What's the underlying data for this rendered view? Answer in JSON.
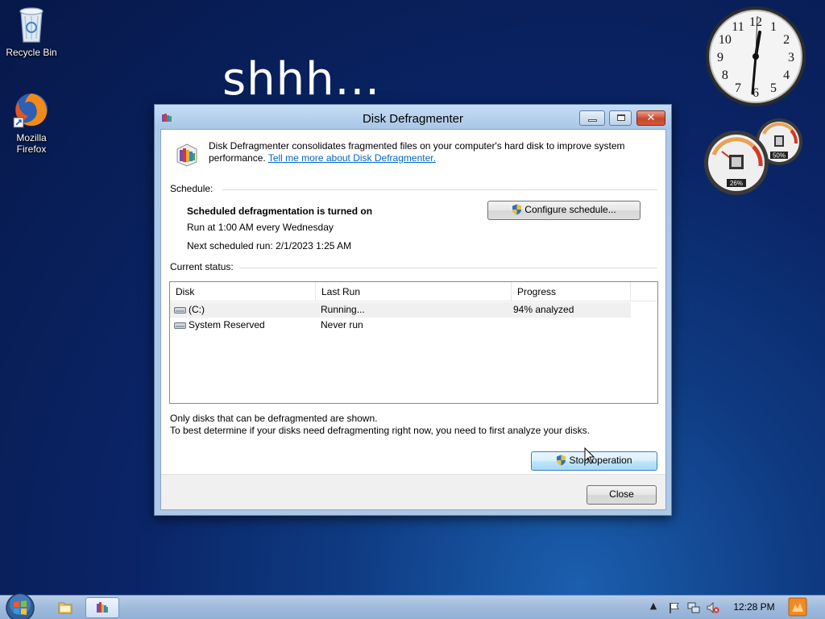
{
  "desktop": {
    "icons": [
      {
        "label": "Recycle Bin",
        "icon": "recycle-bin-icon"
      },
      {
        "label": "Mozilla\nFirefox",
        "icon": "firefox-icon"
      }
    ],
    "wallpaper_text": "shhh..."
  },
  "gadgets": {
    "clock": {
      "time": "12:28",
      "numerals": [
        "12",
        "1",
        "2",
        "3",
        "4",
        "5",
        "6",
        "7",
        "8",
        "9",
        "10",
        "11"
      ]
    },
    "cpu_meter": {
      "cpu_percent": "26%",
      "memory_percent": "50%"
    }
  },
  "window": {
    "title": "Disk Defragmenter",
    "intro_text": "Disk Defragmenter consolidates fragmented files on your computer's hard disk to improve system performance. ",
    "intro_link": "Tell me more about Disk Defragmenter.",
    "schedule": {
      "label": "Schedule:",
      "status": "Scheduled defragmentation is turned on",
      "run": "Run at 1:00 AM every Wednesday",
      "next_run": "Next scheduled run: 2/1/2023 1:25 AM",
      "configure_button": "Configure schedule..."
    },
    "current_status": {
      "label": "Current status:",
      "columns": [
        "Disk",
        "Last Run",
        "Progress"
      ],
      "rows": [
        {
          "disk": "(C:)",
          "last_run": "Running...",
          "progress": "94% analyzed"
        },
        {
          "disk": "System Reserved",
          "last_run": "Never run",
          "progress": ""
        }
      ]
    },
    "notes": [
      "Only disks that can be defragmented are shown.",
      "To best determine if your disks need defragmenting right now, you need to first analyze your disks."
    ],
    "stop_button": "Stop operation",
    "close_button": "Close",
    "caption_buttons": {
      "minimize": "minimize-icon",
      "maximize": "maximize-icon",
      "close": "close-icon"
    }
  },
  "taskbar": {
    "clock": "12:28 PM",
    "tray": [
      "show-hidden-icons-arrow",
      "action-center-flag-icon",
      "network-icon",
      "volume-muted-icon"
    ]
  },
  "colors": {
    "link": "#0066cc",
    "close_button": "#c9452a",
    "taskbar": "#a9c2e2"
  }
}
